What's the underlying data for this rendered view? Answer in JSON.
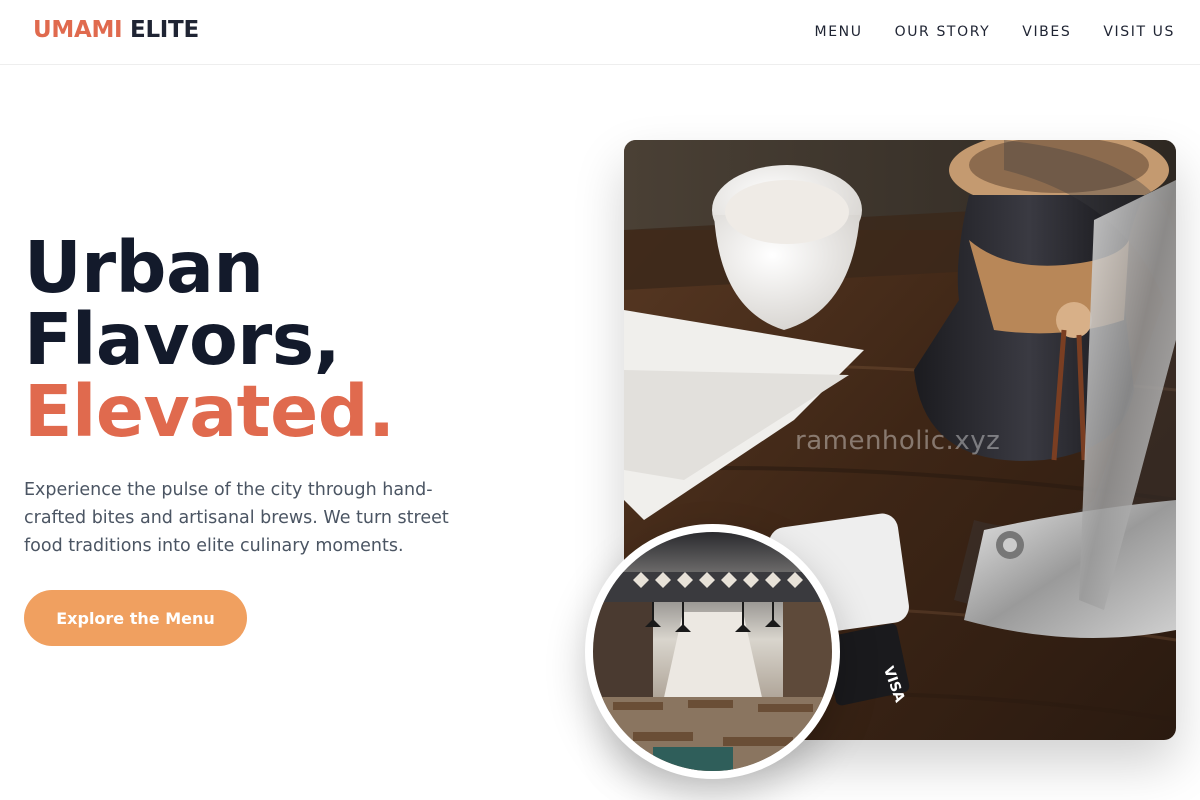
{
  "brand": {
    "part1": "UMAMI",
    "part2": "ELITE"
  },
  "nav": {
    "items": [
      "MENU",
      "OUR STORY",
      "VIBES",
      "VISIT US"
    ]
  },
  "hero": {
    "title_line1": "Urban",
    "title_line2": "Flavors,",
    "title_line3": "Elevated.",
    "description": "Experience the pulse of the city through hand-crafted bites and artisanal brews. We turn street food traditions into elite culinary moments.",
    "cta_label": "Explore the Menu"
  },
  "images": {
    "main_watermark": "ramenholic.xyz",
    "card_text": "VISA"
  },
  "colors": {
    "accent": "#e06a4e",
    "cta": "#f0a060",
    "heading": "#131a2b",
    "body_text": "#4b5563"
  }
}
